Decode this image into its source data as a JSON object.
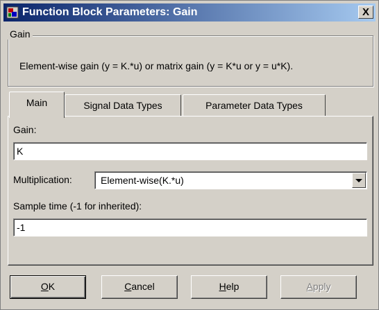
{
  "window": {
    "title": "Function Block Parameters: Gain",
    "close_label": "X",
    "title_color": "#0a246a"
  },
  "group": {
    "legend": "Gain",
    "description": "Element-wise gain (y = K.*u) or matrix gain (y = K*u or y = u*K)."
  },
  "tabs": [
    {
      "label": "Main",
      "active": true
    },
    {
      "label": "Signal Data Types",
      "active": false
    },
    {
      "label": "Parameter Data Types",
      "active": false
    }
  ],
  "main": {
    "gain_label": "Gain:",
    "gain_value": "K",
    "multiplication_label": "Multiplication:",
    "multiplication_value": "Element-wise(K.*u)",
    "sample_time_label": "Sample time (-1 for inherited):",
    "sample_time_value": "-1"
  },
  "buttons": {
    "ok": {
      "mnemonic": "O",
      "rest": "K"
    },
    "cancel": {
      "mnemonic": "C",
      "rest": "ancel"
    },
    "help": {
      "mnemonic": "H",
      "rest": "elp"
    },
    "apply": {
      "mnemonic": "A",
      "rest": "pply",
      "enabled": false
    }
  }
}
